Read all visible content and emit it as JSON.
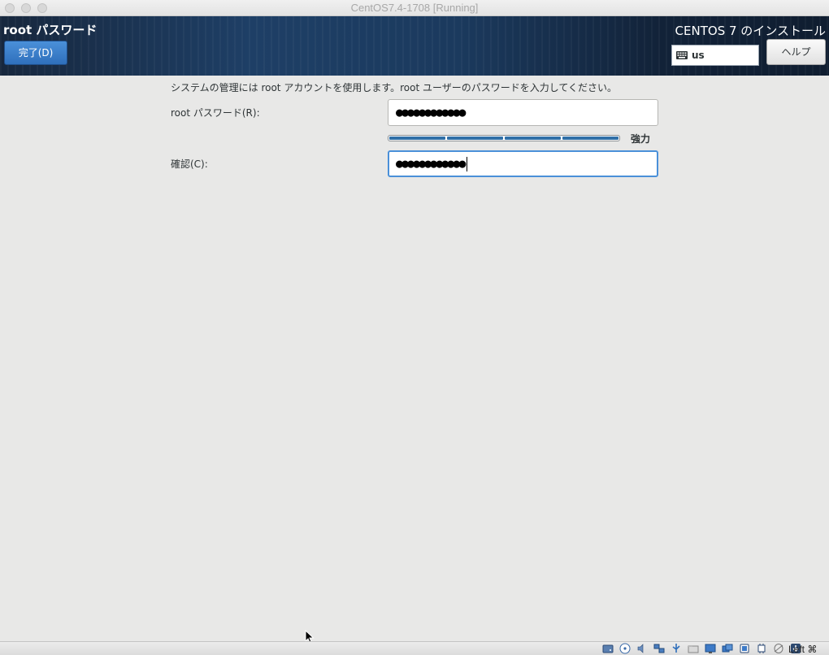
{
  "window": {
    "title": "CentOS7.4-1708 [Running]"
  },
  "header": {
    "page_title": "root パスワード",
    "done_label": "完了(D)",
    "product_title": "CENTOS 7 のインストール",
    "keyboard_layout": "us",
    "help_label": "ヘルプ"
  },
  "form": {
    "intro_text": "システムの管理には  root アカウントを使用します。root ユーザーのパスワードを入力してください。",
    "password_label": "root パスワード(R):",
    "password_value": "●●●●●●●●●●●●",
    "strength_label": "強力",
    "strength_level": 1.0,
    "confirm_label": "確認(C):",
    "confirm_value": "●●●●●●●●●●●●"
  },
  "statusbar": {
    "icons": [
      "hard-disk-icon",
      "optical-drive-icon",
      "audio-icon",
      "network-icon",
      "usb-icon",
      "shared-folders-icon",
      "display-icon",
      "screen-capture-icon",
      "video-capture-icon",
      "cpu-icon",
      "mouse-integration-icon",
      "download-arrow-icon"
    ],
    "host_key": "Left ⌘"
  },
  "colors": {
    "accent": "#4a90d9",
    "header_bg": "#1b3a5e",
    "strength_bar": "#2f6fa7",
    "content_bg": "#e8e8e7"
  }
}
